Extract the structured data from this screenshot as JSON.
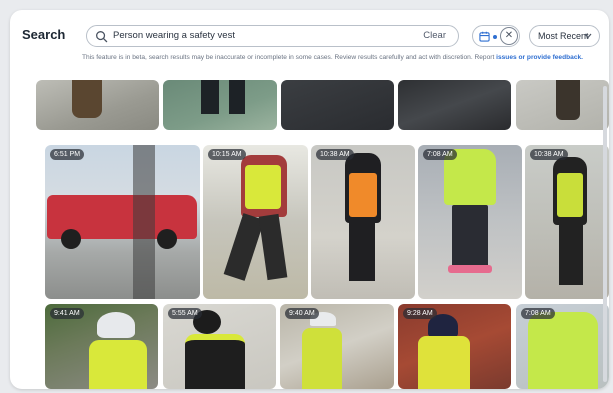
{
  "header": {
    "title": "Search",
    "search_value": "Person wearing a safety vest",
    "clear_label": "Clear",
    "sort_label": "Most Recent",
    "beta_text": "This feature is in beta, search results may be inaccurate or incomplete in some cases. Review results carefully and act with discretion. Report",
    "beta_link": "issues or provide feedback."
  },
  "colors": {
    "accent": "#2f6fd1",
    "vest_yellow": "#d9e83a",
    "vest_orange": "#f08a2a"
  },
  "icons": [
    "search-icon",
    "calendar-icon",
    "close-icon",
    "chevron-down-icon"
  ],
  "rows": {
    "middle": [
      "6:51 PM",
      "10:15 AM",
      "10:38 AM",
      "7:08 AM",
      "10:38 AM"
    ],
    "bottom": [
      "9:41 AM",
      "5:55 AM",
      "9:40 AM",
      "9:28 AM",
      "7:08 AM"
    ]
  }
}
